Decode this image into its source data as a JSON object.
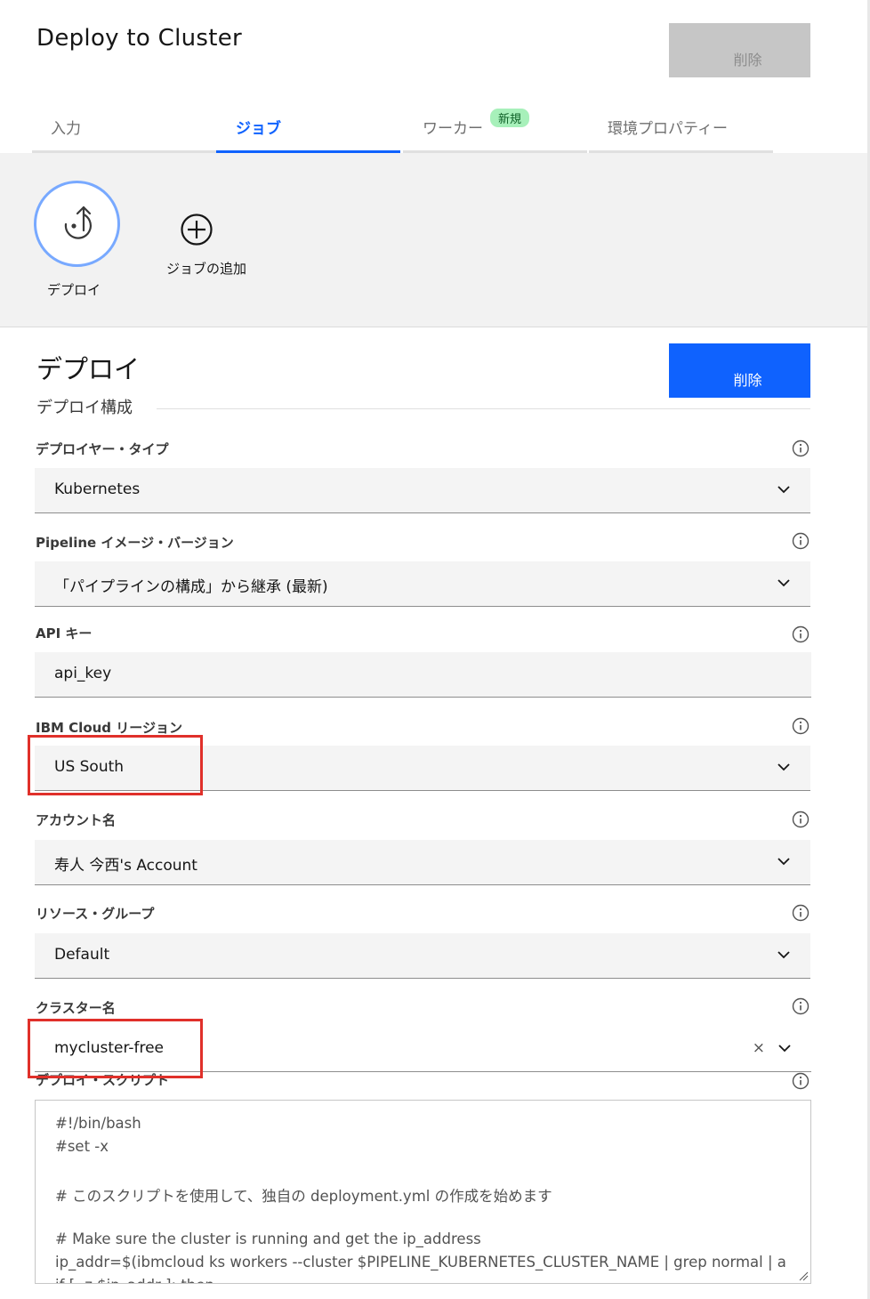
{
  "header": {
    "title": "Deploy to Cluster",
    "delete_disabled_label": "削除"
  },
  "tabs": [
    {
      "label": "入力",
      "active": false
    },
    {
      "label": "ジョブ",
      "active": true
    },
    {
      "label": "ワーカー",
      "active": false,
      "badge": "新規"
    },
    {
      "label": "環境プロパティー",
      "active": false
    }
  ],
  "jobs": {
    "current_job_label": "デプロイ",
    "current_job_icon": "deploy-icon",
    "add_job_label": "ジョブの追加",
    "add_job_icon": "add-circle-icon"
  },
  "job_detail": {
    "title": "デプロイ",
    "delete_label": "削除",
    "subsection": "デプロイ構成"
  },
  "fields": {
    "deployer_type": {
      "label": "デプロイヤー・タイプ",
      "value": "Kubernetes"
    },
    "pipeline_image": {
      "label": "Pipeline イメージ・バージョン",
      "value": "「パイプラインの構成」から継承 (最新)"
    },
    "api_key": {
      "label": "API キー",
      "value": "api_key"
    },
    "region": {
      "label": "IBM Cloud リージョン",
      "value": "US South"
    },
    "account": {
      "label": "アカウント名",
      "value": "寿人 今西's Account"
    },
    "resource_group": {
      "label": "リソース・グループ",
      "value": "Default"
    },
    "cluster": {
      "label": "クラスター名",
      "value": "mycluster-free",
      "clear": "×"
    },
    "deploy_script": {
      "label": "デプロイ・スクリプト",
      "lines": [
        "#!/bin/bash",
        "#set -x",
        "",
        "# このスクリプトを使用して、独自の deployment.yml の作成を始めます",
        "",
        "# Make sure the cluster is running and get the ip_address",
        "ip_addr=$(ibmcloud ks workers --cluster $PIPELINE_KUBERNETES_CLUSTER_NAME | grep normal | a",
        "if [ -z $ip_addr ]; then"
      ]
    }
  },
  "colors": {
    "accent": "#0f62fe",
    "highlight_box": "#e0302a",
    "badge_bg": "#a7f0ba"
  }
}
